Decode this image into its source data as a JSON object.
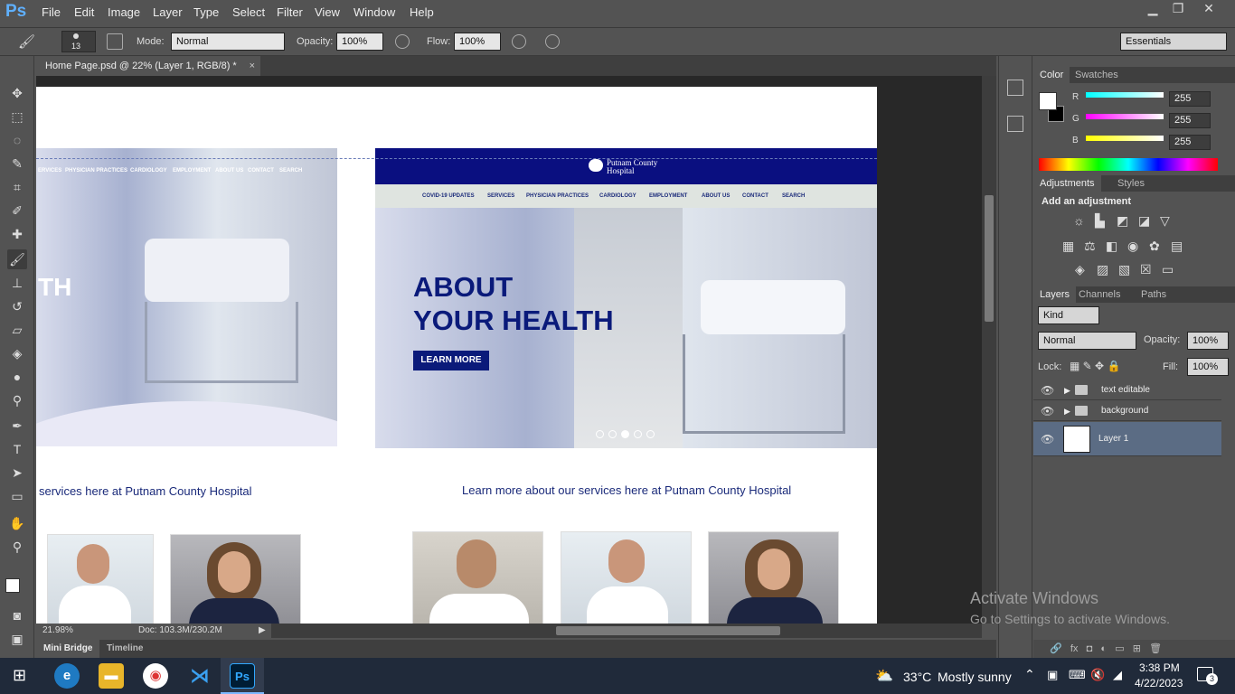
{
  "app": {
    "logo": "Ps"
  },
  "menu": [
    "File",
    "Edit",
    "Image",
    "Layer",
    "Type",
    "Select",
    "Filter",
    "View",
    "Window",
    "Help"
  ],
  "window_controls": {
    "minimize": "▁",
    "restore": "❐",
    "close": "✕"
  },
  "options": {
    "brush_size": "13",
    "mode_label": "Mode:",
    "mode_value": "Normal",
    "opacity_label": "Opacity:",
    "opacity_value": "100%",
    "flow_label": "Flow:",
    "flow_value": "100%",
    "workspace": "Essentials"
  },
  "document": {
    "tab_title": "Home Page.psd @ 22% (Layer 1, RGB/8) *",
    "zoom": "21.98%",
    "doc_size": "Doc: 103.3M/230.2M"
  },
  "website": {
    "logo_text": "Putnam County Hospital",
    "nav": [
      "COVID-19 UPDATES",
      "SERVICES",
      "PHYSICIAN PRACTICES",
      "CARDIOLOGY",
      "EMPLOYMENT",
      "ABOUT US",
      "CONTACT",
      "SEARCH"
    ],
    "nav_left": [
      "ERVICES",
      "PHYSICIAN PRACTICES",
      "CARDIOLOGY",
      "EMPLOYMENT",
      "ABOUT US",
      "CONTACT",
      "SEARCH"
    ],
    "hero_line1": "ABOUT",
    "hero_line2": "YOUR HEALTH",
    "hero_left_fragment": "TH",
    "cta": "LEARN MORE",
    "tagline": "Learn more about our services here at Putnam County Hospital",
    "tagline_left": "services here at Putnam County Hospital"
  },
  "bottom_tabs": [
    "Mini Bridge",
    "Timeline"
  ],
  "color_panel": {
    "tabs": [
      "Color",
      "Swatches"
    ],
    "r_label": "R",
    "g_label": "G",
    "b_label": "B",
    "r": "255",
    "g": "255",
    "b": "255"
  },
  "adjustments_panel": {
    "tabs": [
      "Adjustments",
      "Styles"
    ],
    "heading": "Add an adjustment"
  },
  "layers_panel": {
    "tabs": [
      "Layers",
      "Channels",
      "Paths"
    ],
    "kind": "Kind",
    "blend": "Normal",
    "opacity_label": "Opacity:",
    "opacity": "100%",
    "lock_label": "Lock:",
    "fill_label": "Fill:",
    "fill": "100%",
    "layers": [
      {
        "name": "text editable"
      },
      {
        "name": "background"
      },
      {
        "name": "Layer 1"
      }
    ]
  },
  "watermark": {
    "title": "Activate Windows",
    "subtitle": "Go to Settings to activate Windows."
  },
  "taskbar": {
    "weather_temp": "33°C",
    "weather_desc": "Mostly sunny",
    "time": "3:38 PM",
    "date": "4/22/2023",
    "notif_count": "3"
  }
}
